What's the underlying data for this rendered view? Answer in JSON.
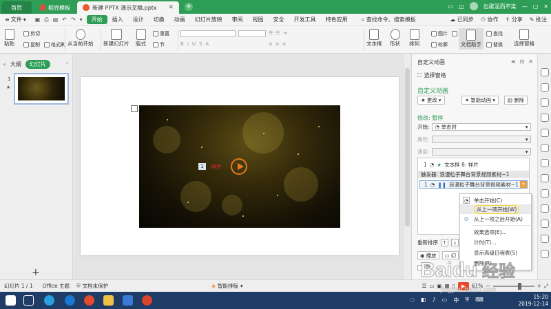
{
  "title_tabs": [
    {
      "label": "首页"
    },
    {
      "label": "稻壳模板"
    },
    {
      "label": "新建 PPTX 演示文稿.pptx"
    }
  ],
  "titlebar_right": {
    "status": "出歌泥而不染"
  },
  "menubar": {
    "file": "文件",
    "items": [
      "开始",
      "插入",
      "设计",
      "切换",
      "动画",
      "幻灯片放映",
      "审阅",
      "视图",
      "安全",
      "开发工具",
      "特色应用"
    ],
    "search": "查找命令、搜索模板",
    "sync": "已同步",
    "collab": "协作",
    "share": "分享",
    "annotate": "批注"
  },
  "ribbon": {
    "paste": "粘贴",
    "cut": "剪切",
    "copy": "复制",
    "format_painter": "格式刷",
    "from_current": "从当前开始",
    "new_slide": "新建幻灯片",
    "layout": "版式",
    "reset": "重置",
    "section": "节",
    "textbox": "文本框",
    "shapes": "形状",
    "arrange": "排列",
    "picture": "图片",
    "fill": "填充",
    "outline": "轮廓",
    "doc_assistant": "文档助手",
    "find": "查找",
    "replace": "替换",
    "select_pane": "选择窗格"
  },
  "outline_panel": {
    "tab_outline": "大纲",
    "tab_slides": "幻灯片",
    "slide_number": "1"
  },
  "slide": {
    "video_index": "1",
    "video_label": "祥片"
  },
  "pane": {
    "title": "自定义动画",
    "select_pane": "选择窗格",
    "heading": "自定义动画",
    "change": "更改",
    "smart_anim": "智能动画",
    "delete": "删除",
    "modify": "修改: 暂停",
    "start_label": "开始:",
    "start_value": "单击时",
    "property_label": "属性:",
    "speed_label": "速度:",
    "list_item1_num": "1",
    "list_item1_text": "文本框 8: 祥片",
    "trigger_text": "触发器: 浪漫粒子舞台背景视频素材~1",
    "list_item2_num": "1",
    "list_item2_text": "浪漫粒子舞台背景视频素材~1",
    "reorder": "重新排序",
    "play": "播放",
    "slideshow": "幻",
    "autoprev": "自"
  },
  "context_menu": {
    "items": [
      "单击开始(C)",
      "从上一项开始(W)",
      "从上一项之后开始(A)",
      "效果选项(E)...",
      "计时(T)...",
      "显示高级日程表(S)",
      "删除(R)"
    ]
  },
  "statusbar": {
    "slide_info": "幻灯片 1 / 1",
    "theme": "Office 主题",
    "doc_protect": "文档未保护",
    "smart_layout": "智能排版",
    "zoom": "61%"
  },
  "taskbar": {
    "time": "15:20",
    "date": "2019-12-14"
  },
  "watermark": {
    "text": "Baidu经验",
    "sub": "jingyan.baidu.com"
  },
  "colors": {
    "brand": "#2e9e56",
    "accent_orange": "#e9791b",
    "taskbar": "#1e3c66"
  }
}
